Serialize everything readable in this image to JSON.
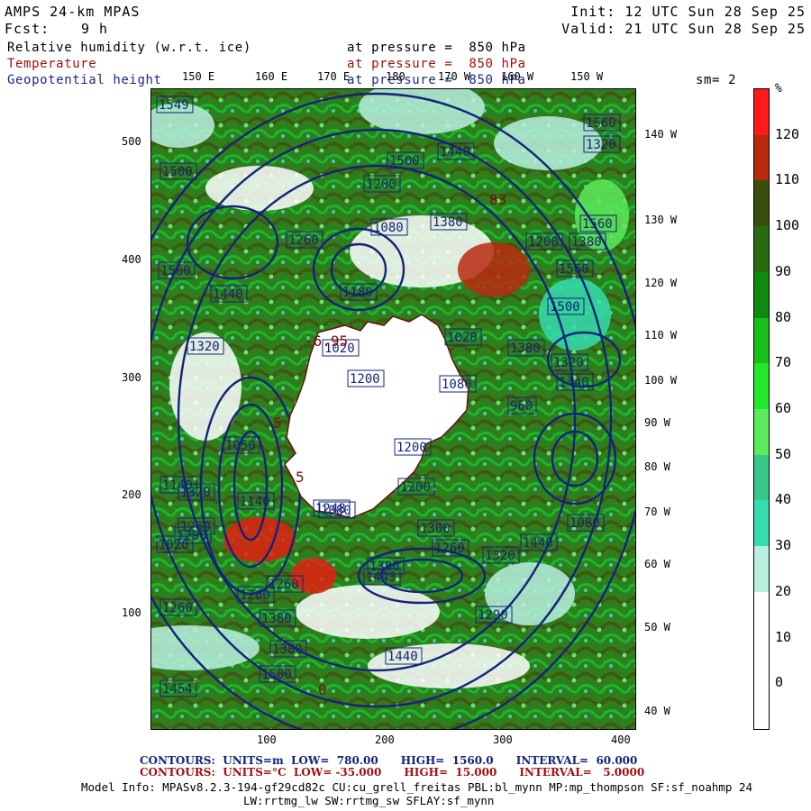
{
  "header": {
    "model": "AMPS 24-km MPAS",
    "init": "Init: 12 UTC Sun 28 Sep 25",
    "fcst_label": "Fcst:",
    "fcst_value": "9 h",
    "valid": "Valid: 21 UTC Sun 28 Sep 25",
    "fields": [
      {
        "name": "Relative humidity (w.r.t. ice)",
        "level": "at pressure =  850 hPa",
        "color": "#000000"
      },
      {
        "name": "Temperature",
        "level": "at pressure =  850 hPa",
        "color": "#a01010"
      },
      {
        "name": "Geopotential height",
        "level": "at pressure =  850 hPa",
        "color": "#1a2a8c"
      }
    ],
    "smoothing": "sm= 2"
  },
  "map": {
    "lon_labels_top": [
      "150 E",
      "160 E",
      "170 E",
      "180",
      "170 W",
      "160 W",
      "150 W"
    ],
    "lon_labels_right": [
      "140 W",
      "130 W",
      "120 W",
      "110 W",
      "100 W",
      "90 W",
      "80 W",
      "70 W",
      "60 W",
      "50 W",
      "40 W"
    ],
    "y_ticks": [
      "500",
      "400",
      "300",
      "200",
      "100"
    ],
    "x_ticks": [
      "100",
      "200",
      "300",
      "400"
    ],
    "height_contour_labels": [
      "1549",
      "1560",
      "1500",
      "1500",
      "1560",
      "1380",
      "1440",
      "1260",
      "1320",
      "1200",
      "1080",
      "1020",
      "1200",
      "960",
      "1020",
      "1080",
      "1140",
      "1260",
      "1380",
      "1560",
      "1320",
      "1443",
      "1200",
      "1260",
      "1380",
      "1440",
      "1500",
      "1454",
      "1380",
      "1290",
      "1180",
      "1050",
      "1248",
      "1140",
      "1020",
      "1290",
      "1300",
      "1080",
      "1440",
      "1320",
      "1260",
      "1200",
      "1440",
      "1500",
      "1380",
      "1560",
      "1320",
      "1380",
      "1440",
      "1080",
      "1200",
      "1260",
      "1320",
      "1200"
    ],
    "temperature_contour_labels": [
      "5",
      "5",
      "-6.95",
      "-",
      "83",
      "0"
    ],
    "colors": {
      "land": "#ffffff",
      "coast": "#6a0f0f",
      "height_contour": "#14237a",
      "temperature_contour": "#7a1010"
    }
  },
  "colorbar": {
    "unit": "%",
    "labels": [
      "120",
      "110",
      "100",
      "90",
      "80",
      "70",
      "60",
      "50",
      "40",
      "30",
      "20",
      "10",
      "0"
    ],
    "colors": [
      "#ff1a1a",
      "#b82a10",
      "#3a4e0c",
      "#2a6a10",
      "#0f8a0f",
      "#17c01a",
      "#22e82a",
      "#5cea5c",
      "#3ac88a",
      "#35dcb0",
      "#b8f0e0",
      "#ffffff",
      "#ffffff",
      "#ffffff"
    ]
  },
  "footer": {
    "contours_height": "CONTOURS:  UNITS=m  LOW=  780.00      HIGH=  1560.0      INTERVAL=  60.000",
    "contours_temp": "CONTOURS:  UNITS=°C  LOW= -35.000      HIGH=  15.000      INTERVAL=   5.0000",
    "model_info_1": "Model Info: MPASv8.2.3-194-gf29cd82c CU:cu_grell_freitas PBL:bl_mynn MP:mp_thompson SF:sf_noahmp 24",
    "model_info_2": "LW:rrtmg_lw SW:rrtmg_sw SFLAY:sf_mynn"
  }
}
